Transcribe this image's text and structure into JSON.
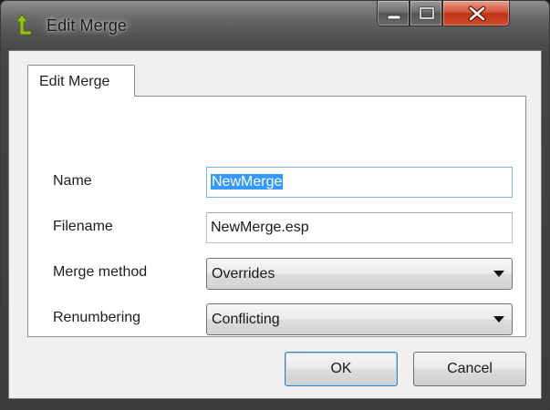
{
  "window": {
    "title": "Edit Merge",
    "icon": "green-up-arrow-icon",
    "caption_buttons": [
      "minimize-icon",
      "maximize-icon",
      "close-icon"
    ]
  },
  "tabs": [
    {
      "label": "Edit Merge",
      "active": true
    }
  ],
  "form": {
    "name": {
      "label": "Name",
      "value": "NewMerge",
      "selected": true
    },
    "filename": {
      "label": "Filename",
      "value": "NewMerge.esp"
    },
    "merge_method": {
      "label": "Merge method",
      "value": "Overrides"
    },
    "renumbering": {
      "label": "Renumbering",
      "value": "Conflicting"
    }
  },
  "buttons": {
    "ok": "OK",
    "cancel": "Cancel"
  },
  "colors": {
    "selection": "#3399ff",
    "close_button": "#c23418",
    "icon": "#9ac31c"
  }
}
